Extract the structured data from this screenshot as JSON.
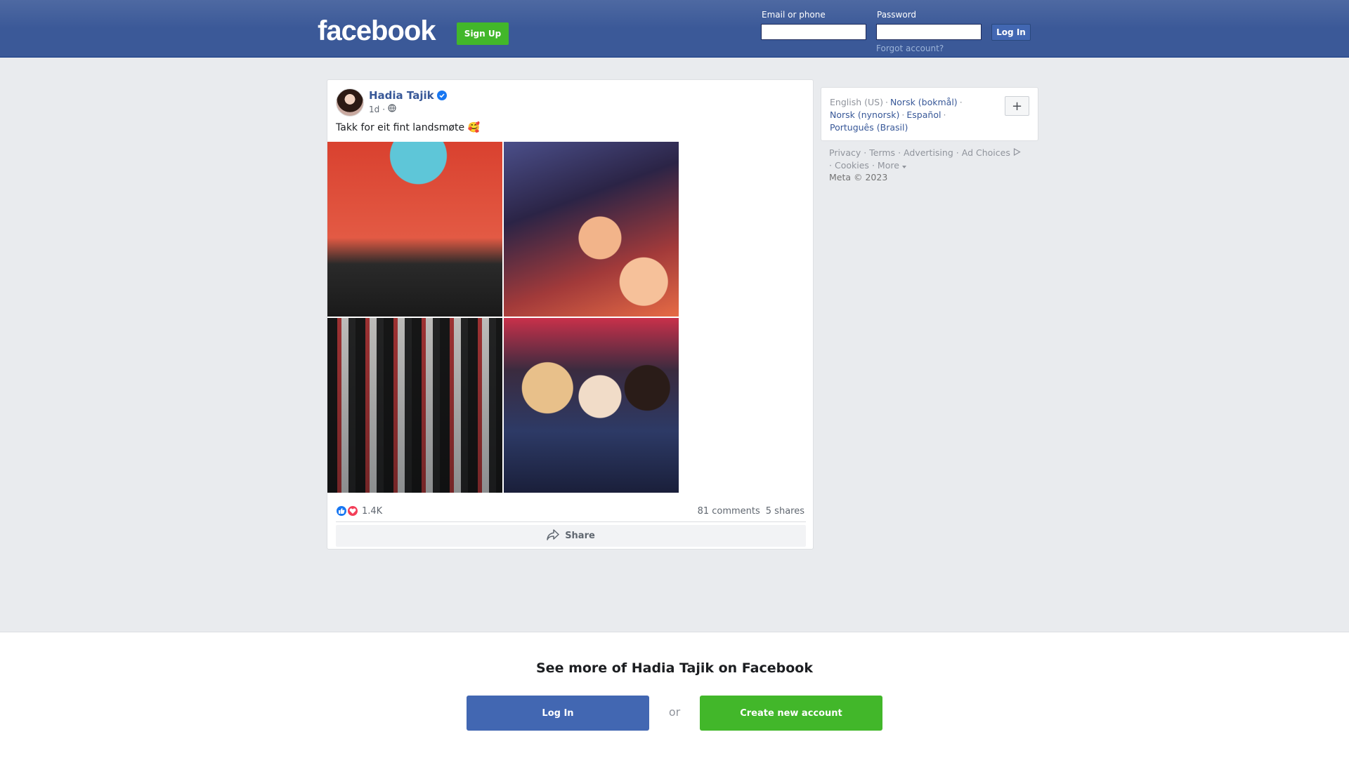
{
  "header": {
    "logo": "facebook",
    "signup_label": "Sign Up",
    "email_label": "Email or phone",
    "password_label": "Password",
    "login_label": "Log In",
    "forgot_label": "Forgot account?"
  },
  "post": {
    "author": "Hadia Tajik",
    "time": "1d",
    "visibility_icon": "globe-icon",
    "verified_icon": "verified-badge-icon",
    "text": "Takk for eit fint landsmøte 🥰",
    "photos": [
      {
        "name": "photo-stage"
      },
      {
        "name": "photo-selfie"
      },
      {
        "name": "photo-group"
      },
      {
        "name": "photo-three-women"
      }
    ],
    "reaction_count": "1.4K",
    "comments": "81 comments",
    "shares": "5 shares",
    "share_label": "Share"
  },
  "languages": {
    "current": "English (US)",
    "items": [
      "Norsk (bokmål)",
      "Norsk (nynorsk)",
      "Español",
      "Português (Brasil)"
    ],
    "more_symbol": "+"
  },
  "footer": {
    "links": [
      "Privacy",
      "Terms",
      "Advertising",
      "Ad Choices",
      "Cookies",
      "More"
    ],
    "copyright": "Meta © 2023"
  },
  "bottom_prompt": {
    "title": "See more of Hadia Tajik on Facebook",
    "login_label": "Log In",
    "or_label": "or",
    "create_label": "Create new account"
  },
  "colors": {
    "brand_blue": "#3b5998",
    "button_blue": "#4267b2",
    "green": "#42b72a",
    "link": "#385898"
  }
}
